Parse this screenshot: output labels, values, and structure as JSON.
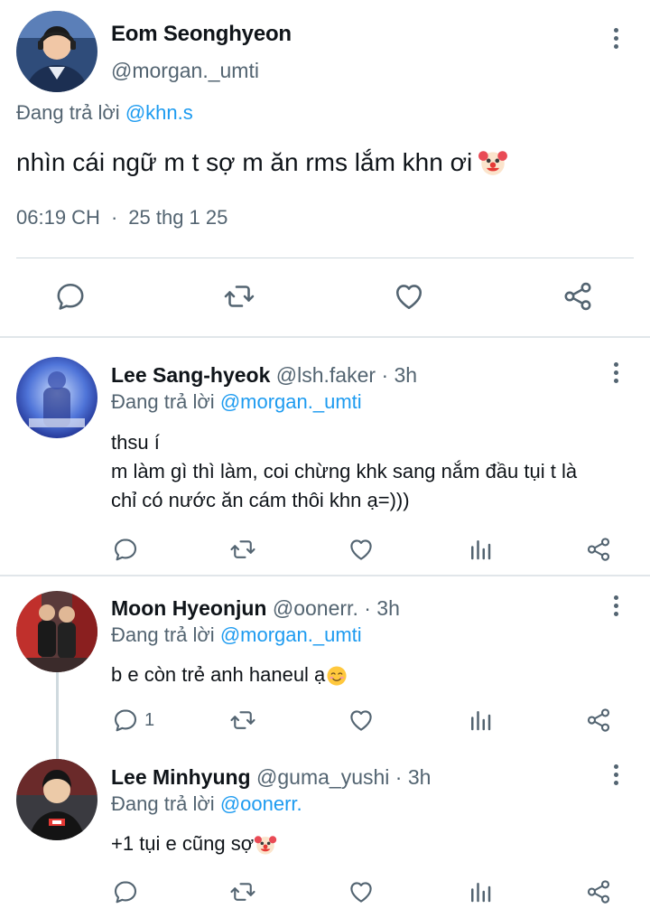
{
  "main_tweet": {
    "display_name": "Eom Seonghyeon",
    "handle": "@morgan._umti",
    "replying_label": "Đang trả lời",
    "replying_to": "@khn.s",
    "text": "nhìn cái ngữ m t sợ m ăn rms lắm khn ơi",
    "text_emoji": "clown-face-emoji",
    "time": "06:19 CH",
    "separator": "·",
    "date": "25 thg 1 25"
  },
  "replies": [
    {
      "display_name": "Lee Sang-hyeok",
      "handle": "@lsh.faker",
      "separator": "·",
      "age": "3h",
      "replying_label": "Đang trả lời",
      "replying_to": "@morgan._umti",
      "lines": [
        "thsu í",
        "m làm gì thì làm, coi chừng khk sang nắm đầu tụi t là",
        "chỉ có nước ăn cám thôi khn ạ=)))"
      ],
      "reply_count": ""
    },
    {
      "display_name": "Moon Hyeonjun",
      "handle": "@oonerr.",
      "separator": "·",
      "age": "3h",
      "replying_label": "Đang trả lời",
      "replying_to": "@morgan._umti",
      "lines": [
        "b e còn trẻ anh haneul ạ"
      ],
      "text_emoji": "smiling-face-emoji",
      "reply_count": "1"
    },
    {
      "display_name": "Lee Minhyung",
      "handle": "@guma_yushi",
      "separator": "·",
      "age": "3h",
      "replying_label": "Đang trả lời",
      "replying_to": "@oonerr.",
      "lines": [
        "+1 tụi e cũng sợ"
      ],
      "text_emoji": "clown-face-emoji",
      "reply_count": ""
    }
  ],
  "colors": {
    "accent": "#1d9bf0",
    "secondary_text": "#536471",
    "icon": "#536471",
    "divider": "#cfd9de"
  },
  "icons": {
    "reply": "reply-icon",
    "retweet": "retweet-icon",
    "like": "heart-icon",
    "views": "views-icon",
    "share": "share-icon",
    "more": "more-vertical-icon"
  }
}
